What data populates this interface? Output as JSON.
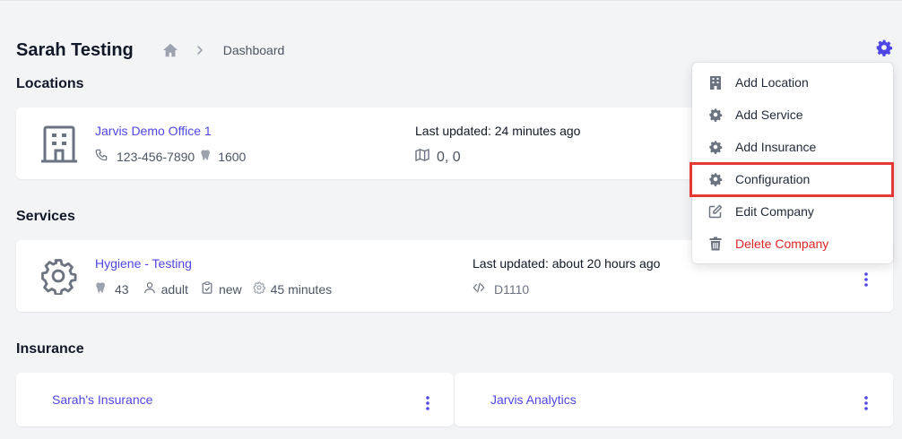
{
  "page": {
    "title": "Sarah Testing",
    "breadcrumb": {
      "current": "Dashboard"
    }
  },
  "sections": {
    "locations": "Locations",
    "services": "Services",
    "insurance": "Insurance"
  },
  "location": {
    "name": "Jarvis Demo Office 1",
    "phone": "123-456-7890",
    "count": "1600",
    "updated": "Last updated: 24 minutes ago",
    "coords": "0, 0"
  },
  "service": {
    "name": "Hygiene - Testing",
    "teeth": "43",
    "patient": "adult",
    "status": "new",
    "duration": "45 minutes",
    "updated": "Last updated: about 20 hours ago",
    "code": "D1110"
  },
  "insurance": [
    {
      "name": "Sarah's Insurance"
    },
    {
      "name": "Jarvis Analytics"
    }
  ],
  "menu": {
    "items": [
      {
        "label": "Add Location",
        "icon": "building-icon"
      },
      {
        "label": "Add Service",
        "icon": "cog-icon"
      },
      {
        "label": "Add Insurance",
        "icon": "cog-icon"
      },
      {
        "label": "Configuration",
        "icon": "cog-icon",
        "highlighted": true
      },
      {
        "label": "Edit Company",
        "icon": "edit-icon"
      },
      {
        "label": "Delete Company",
        "icon": "trash-icon",
        "danger": true
      }
    ]
  },
  "colors": {
    "accent": "#4f46e5",
    "danger": "#dc2626",
    "highlight": "#e53935",
    "background": "#f3f4f6"
  }
}
